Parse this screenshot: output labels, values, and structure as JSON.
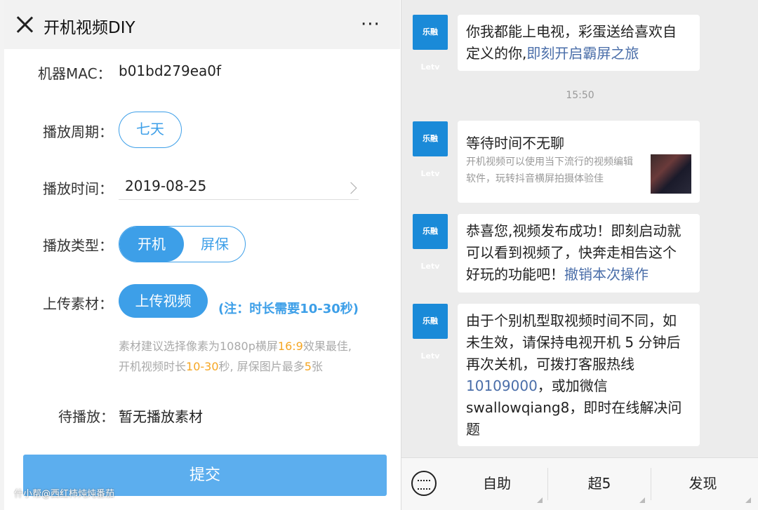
{
  "left": {
    "header": {
      "title": "开机视频DIY",
      "more": "···"
    },
    "mac": {
      "label": "机器MAC：",
      "value": "b01bd279ea0f"
    },
    "cycle": {
      "label": "播放周期：",
      "value": "七天"
    },
    "time": {
      "label": "播放时间：",
      "value": "2019-08-25"
    },
    "type": {
      "label": "播放类型：",
      "options": [
        "开机",
        "屏保"
      ],
      "selected": "开机"
    },
    "upload": {
      "label": "上传素材：",
      "button": "上传视频",
      "note": "(注：时长需要10-30秒)"
    },
    "hint": {
      "line1_a": "素材建议选择像素为1080p横屏",
      "line1_b": "16:9",
      "line1_c": "效果最佳,",
      "line2_a": "开机视频时长",
      "line2_b": "10-30",
      "line2_c": "秒, 屏保图片最多",
      "line2_d": "5",
      "line2_e": "张"
    },
    "pending": {
      "label": "待播放：",
      "value": "暂无播放素材"
    },
    "submit": "提交",
    "watermark": "什小帮@西红柿炖炖番茄"
  },
  "right": {
    "avatar_text": "乐融 Letv",
    "msg1": {
      "line1": "你我都能上电视，彩蛋送给喜欢自",
      "line2_a": "定义的你,",
      "line2_link": "即刻开启霸屏之旅"
    },
    "timestamp": "15:50",
    "card": {
      "title": "等待时间不无聊",
      "desc": "开机视频可以使用当下流行的视频编辑软件，玩转抖音横屏拍摄体验佳"
    },
    "msg3": {
      "line1": "恭喜您,视频发布成功！即刻启动就",
      "line2": "可以看到视频了，快奔走相告这个",
      "line3_a": "好玩的功能吧！",
      "line3_link": "撤销本次操作"
    },
    "msg4": {
      "line1": "由于个别机型取视频时间不同，如",
      "line2": "未生效，请保持电视开机 5 分钟后",
      "line3": "再次关机，可拨打客服热线",
      "line4_link": "10109000",
      "line4_b": "，或加微信",
      "line5": "swallowqiang8，即时在线解决问",
      "line6": "题"
    },
    "menu": [
      "自助",
      "超5",
      "发现"
    ]
  }
}
